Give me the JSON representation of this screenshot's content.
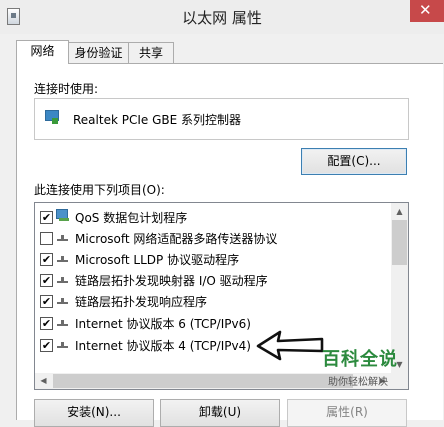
{
  "window": {
    "title": "以太网 属性"
  },
  "tabs": [
    {
      "label": "网络",
      "active": true
    },
    {
      "label": "身份验证",
      "active": false
    },
    {
      "label": "共享",
      "active": false
    }
  ],
  "connect_using": {
    "label": "连接时使用:",
    "adapter": "Realtek PCIe GBE 系列控制器",
    "configure_button": "配置(C)..."
  },
  "items_section": {
    "label": "此连接使用下列项目(O):",
    "items": [
      {
        "label": "QoS 数据包计划程序",
        "checked": true,
        "icon": "qos-icon"
      },
      {
        "label": "Microsoft 网络适配器多路传送器协议",
        "checked": false,
        "icon": "protocol-icon"
      },
      {
        "label": "Microsoft LLDP 协议驱动程序",
        "checked": true,
        "icon": "protocol-icon"
      },
      {
        "label": "链路层拓扑发现映射器 I/O 驱动程序",
        "checked": true,
        "icon": "protocol-icon"
      },
      {
        "label": "链路层拓扑发现响应程序",
        "checked": true,
        "icon": "protocol-icon"
      },
      {
        "label": "Internet 协议版本 6 (TCP/IPv6)",
        "checked": true,
        "icon": "protocol-icon"
      },
      {
        "label": "Internet 协议版本 4 (TCP/IPv4)",
        "checked": true,
        "icon": "protocol-icon"
      }
    ]
  },
  "buttons": {
    "install": "安装(N)...",
    "uninstall": "卸载(U)",
    "properties": "属性(R)"
  },
  "watermark": {
    "brand": "百科全说",
    "tagline": "助你轻松解决"
  },
  "colors": {
    "close": "#c7494a",
    "watermark": "#2c8a3e",
    "focus_border": "#3c7fb1"
  }
}
